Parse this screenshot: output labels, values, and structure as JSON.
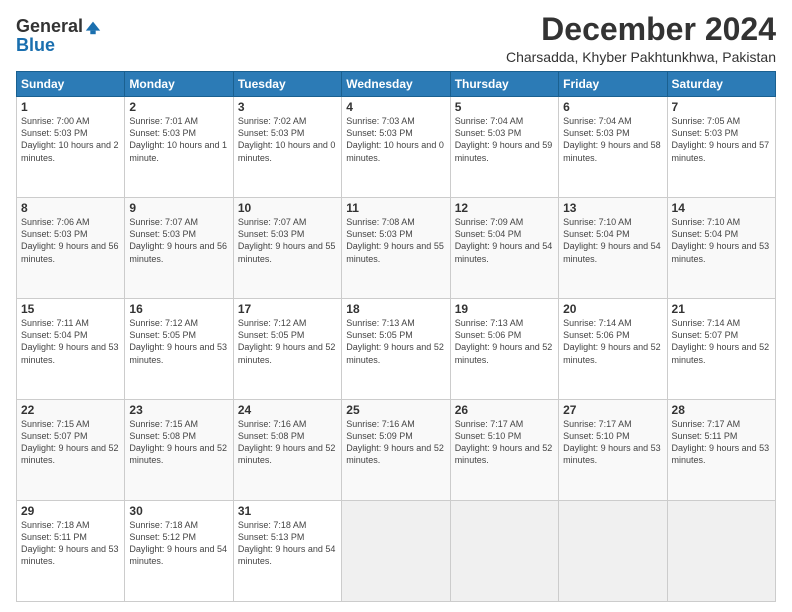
{
  "logo": {
    "general": "General",
    "blue": "Blue"
  },
  "title": {
    "month": "December 2024",
    "location": "Charsadda, Khyber Pakhtunkhwa, Pakistan"
  },
  "weekdays": [
    "Sunday",
    "Monday",
    "Tuesday",
    "Wednesday",
    "Thursday",
    "Friday",
    "Saturday"
  ],
  "weeks": [
    [
      {
        "day": "1",
        "sunrise": "7:00 AM",
        "sunset": "5:03 PM",
        "daylight": "10 hours and 2 minutes."
      },
      {
        "day": "2",
        "sunrise": "7:01 AM",
        "sunset": "5:03 PM",
        "daylight": "10 hours and 1 minute."
      },
      {
        "day": "3",
        "sunrise": "7:02 AM",
        "sunset": "5:03 PM",
        "daylight": "10 hours and 0 minutes."
      },
      {
        "day": "4",
        "sunrise": "7:03 AM",
        "sunset": "5:03 PM",
        "daylight": "10 hours and 0 minutes."
      },
      {
        "day": "5",
        "sunrise": "7:04 AM",
        "sunset": "5:03 PM",
        "daylight": "9 hours and 59 minutes."
      },
      {
        "day": "6",
        "sunrise": "7:04 AM",
        "sunset": "5:03 PM",
        "daylight": "9 hours and 58 minutes."
      },
      {
        "day": "7",
        "sunrise": "7:05 AM",
        "sunset": "5:03 PM",
        "daylight": "9 hours and 57 minutes."
      }
    ],
    [
      {
        "day": "8",
        "sunrise": "7:06 AM",
        "sunset": "5:03 PM",
        "daylight": "9 hours and 56 minutes."
      },
      {
        "day": "9",
        "sunrise": "7:07 AM",
        "sunset": "5:03 PM",
        "daylight": "9 hours and 56 minutes."
      },
      {
        "day": "10",
        "sunrise": "7:07 AM",
        "sunset": "5:03 PM",
        "daylight": "9 hours and 55 minutes."
      },
      {
        "day": "11",
        "sunrise": "7:08 AM",
        "sunset": "5:03 PM",
        "daylight": "9 hours and 55 minutes."
      },
      {
        "day": "12",
        "sunrise": "7:09 AM",
        "sunset": "5:04 PM",
        "daylight": "9 hours and 54 minutes."
      },
      {
        "day": "13",
        "sunrise": "7:10 AM",
        "sunset": "5:04 PM",
        "daylight": "9 hours and 54 minutes."
      },
      {
        "day": "14",
        "sunrise": "7:10 AM",
        "sunset": "5:04 PM",
        "daylight": "9 hours and 53 minutes."
      }
    ],
    [
      {
        "day": "15",
        "sunrise": "7:11 AM",
        "sunset": "5:04 PM",
        "daylight": "9 hours and 53 minutes."
      },
      {
        "day": "16",
        "sunrise": "7:12 AM",
        "sunset": "5:05 PM",
        "daylight": "9 hours and 53 minutes."
      },
      {
        "day": "17",
        "sunrise": "7:12 AM",
        "sunset": "5:05 PM",
        "daylight": "9 hours and 52 minutes."
      },
      {
        "day": "18",
        "sunrise": "7:13 AM",
        "sunset": "5:05 PM",
        "daylight": "9 hours and 52 minutes."
      },
      {
        "day": "19",
        "sunrise": "7:13 AM",
        "sunset": "5:06 PM",
        "daylight": "9 hours and 52 minutes."
      },
      {
        "day": "20",
        "sunrise": "7:14 AM",
        "sunset": "5:06 PM",
        "daylight": "9 hours and 52 minutes."
      },
      {
        "day": "21",
        "sunrise": "7:14 AM",
        "sunset": "5:07 PM",
        "daylight": "9 hours and 52 minutes."
      }
    ],
    [
      {
        "day": "22",
        "sunrise": "7:15 AM",
        "sunset": "5:07 PM",
        "daylight": "9 hours and 52 minutes."
      },
      {
        "day": "23",
        "sunrise": "7:15 AM",
        "sunset": "5:08 PM",
        "daylight": "9 hours and 52 minutes."
      },
      {
        "day": "24",
        "sunrise": "7:16 AM",
        "sunset": "5:08 PM",
        "daylight": "9 hours and 52 minutes."
      },
      {
        "day": "25",
        "sunrise": "7:16 AM",
        "sunset": "5:09 PM",
        "daylight": "9 hours and 52 minutes."
      },
      {
        "day": "26",
        "sunrise": "7:17 AM",
        "sunset": "5:10 PM",
        "daylight": "9 hours and 52 minutes."
      },
      {
        "day": "27",
        "sunrise": "7:17 AM",
        "sunset": "5:10 PM",
        "daylight": "9 hours and 53 minutes."
      },
      {
        "day": "28",
        "sunrise": "7:17 AM",
        "sunset": "5:11 PM",
        "daylight": "9 hours and 53 minutes."
      }
    ],
    [
      {
        "day": "29",
        "sunrise": "7:18 AM",
        "sunset": "5:11 PM",
        "daylight": "9 hours and 53 minutes."
      },
      {
        "day": "30",
        "sunrise": "7:18 AM",
        "sunset": "5:12 PM",
        "daylight": "9 hours and 54 minutes."
      },
      {
        "day": "31",
        "sunrise": "7:18 AM",
        "sunset": "5:13 PM",
        "daylight": "9 hours and 54 minutes."
      },
      null,
      null,
      null,
      null
    ]
  ]
}
